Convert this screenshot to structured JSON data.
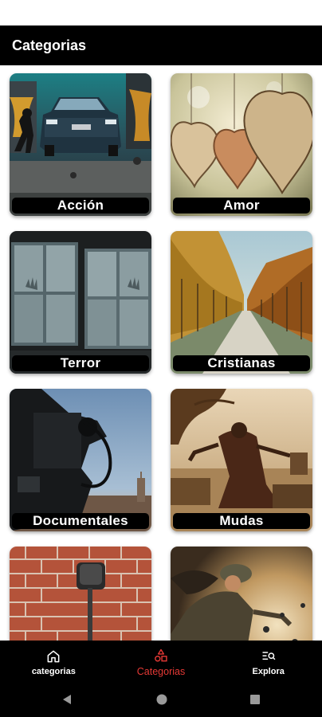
{
  "app": {
    "title": "Categorias"
  },
  "categories": [
    {
      "label": "Acción"
    },
    {
      "label": "Amor"
    },
    {
      "label": "Terror"
    },
    {
      "label": "Cristianas"
    },
    {
      "label": "Documentales"
    },
    {
      "label": "Mudas"
    },
    {
      "label": ""
    },
    {
      "label": ""
    }
  ],
  "bottom_nav": {
    "items": [
      {
        "label": "categorias",
        "icon": "home-icon",
        "active": false
      },
      {
        "label": "Categorias",
        "icon": "shapes-icon",
        "active": true
      },
      {
        "label": "Explora",
        "icon": "search-list-icon",
        "active": false
      }
    ],
    "colors": {
      "active": "#e53935",
      "inactive": "#ffffff",
      "background": "#000000"
    }
  },
  "system_nav": {
    "buttons": [
      "back-icon",
      "home-icon",
      "recents-icon"
    ]
  }
}
